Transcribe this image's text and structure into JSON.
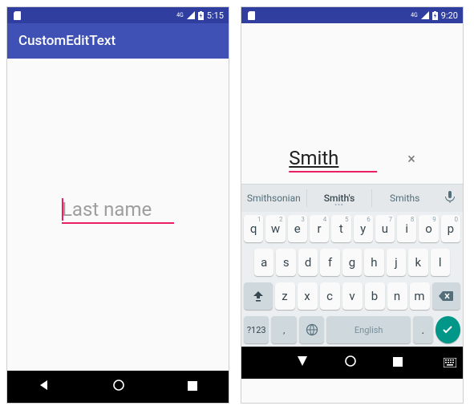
{
  "left": {
    "status": {
      "time": "5:15",
      "network": "4G"
    },
    "appbar": {
      "title": "CustomEditText"
    },
    "field": {
      "placeholder": "Last name",
      "value": ""
    }
  },
  "right": {
    "status": {
      "time": "9:20",
      "network": "4G"
    },
    "field": {
      "value": "Smith",
      "clear_icon": "×"
    },
    "suggestions": [
      "Smithsonian",
      "Smith's",
      "Smiths"
    ],
    "keyboard": {
      "row1": [
        {
          "k": "q",
          "n": "1"
        },
        {
          "k": "w",
          "n": "2"
        },
        {
          "k": "e",
          "n": "3"
        },
        {
          "k": "r",
          "n": "4"
        },
        {
          "k": "t",
          "n": "5"
        },
        {
          "k": "y",
          "n": "6"
        },
        {
          "k": "u",
          "n": "7"
        },
        {
          "k": "i",
          "n": "8"
        },
        {
          "k": "o",
          "n": "9"
        },
        {
          "k": "p",
          "n": "0"
        }
      ],
      "row2": [
        "a",
        "s",
        "d",
        "f",
        "g",
        "h",
        "j",
        "k",
        "l"
      ],
      "row3": [
        "z",
        "x",
        "c",
        "v",
        "b",
        "n",
        "m"
      ],
      "symbols": "?123",
      "space": "English",
      "period": "."
    }
  }
}
